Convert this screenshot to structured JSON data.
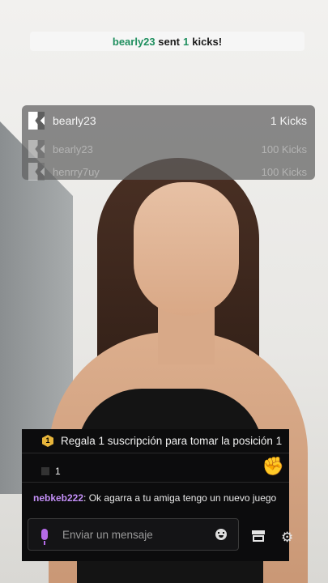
{
  "notification": {
    "user": "bearly23",
    "text_sent": "sent",
    "count": "1",
    "text_kicks": "kicks!"
  },
  "leaderboard": {
    "rows": [
      {
        "name": "bearly23",
        "amount": "1 Kicks"
      },
      {
        "name": "bearly23",
        "amount": "100 Kicks"
      },
      {
        "name": "henrry7uy",
        "amount": "100 Kicks"
      }
    ]
  },
  "chat": {
    "pinned_text": "Regala 1 suscripción para tomar la posición 1",
    "pinned_badge": "1",
    "gift_count": "1",
    "message": {
      "author": "nebkeb222",
      "separator": ":",
      "text": " Ok agarra a tu amiga tengo un nuevo juego"
    },
    "input_placeholder": "Enviar un mensaje"
  },
  "icons": {
    "kick_logo": "kick-logo-icon",
    "mic": "microphone-icon",
    "emoji": "emoji-icon",
    "store": "store-icon",
    "settings": "settings-gear-icon",
    "hand": "hand-emoji-icon"
  },
  "colors": {
    "kick_green": "#1f8f5f",
    "username_purple": "#c38ff7",
    "badge_gold": "#e7b53b"
  }
}
